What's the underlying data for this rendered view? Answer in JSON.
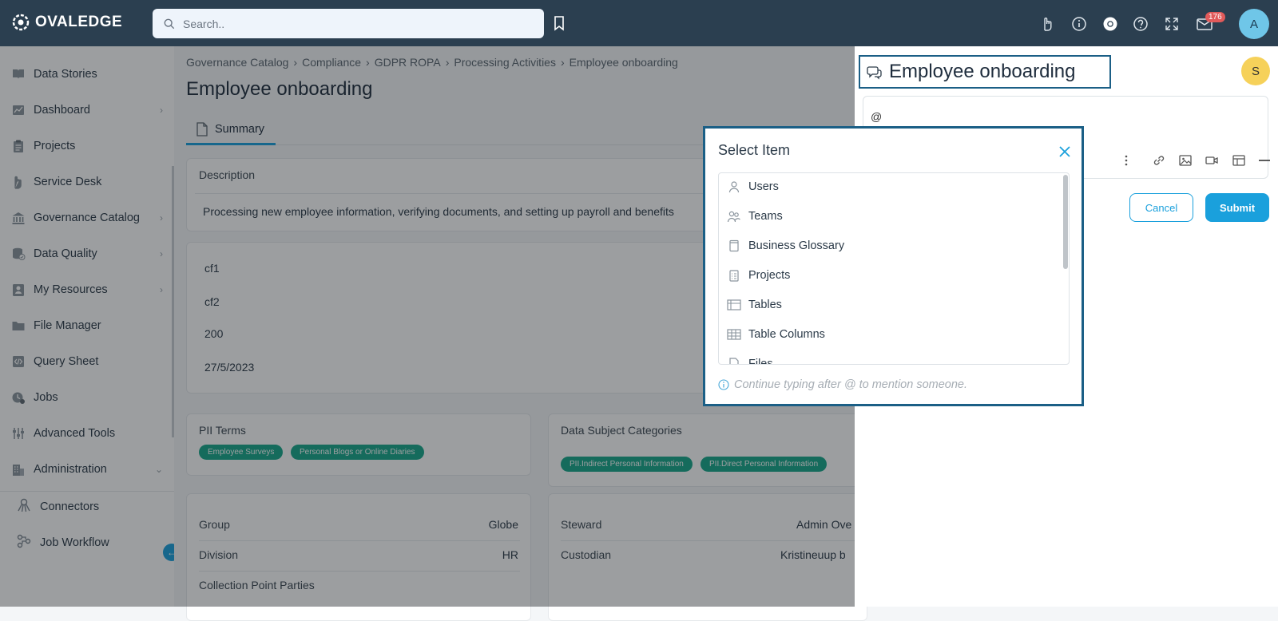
{
  "app": {
    "brand": "OVALEDGE",
    "brand_color": "#2b3f50",
    "accent": "#1aa0dc"
  },
  "topbar": {
    "search_placeholder": "Search..",
    "notification_count": "176",
    "user_initial": "A",
    "icons": [
      "bookmark-icon",
      "hand-icon",
      "info-icon",
      "chrome-icon",
      "help-icon",
      "expand-icon",
      "mail-icon"
    ]
  },
  "sidebar": {
    "items": [
      {
        "label": "Data Stories",
        "icon": "book-icon",
        "expandable": false
      },
      {
        "label": "Dashboard",
        "icon": "chart-icon",
        "expandable": true
      },
      {
        "label": "Projects",
        "icon": "clipboard-icon",
        "expandable": false
      },
      {
        "label": "Service Desk",
        "icon": "hand-icon",
        "expandable": false
      },
      {
        "label": "Governance Catalog",
        "icon": "bank-icon",
        "expandable": true
      },
      {
        "label": "Data Quality",
        "icon": "database-icon",
        "expandable": true
      },
      {
        "label": "My Resources",
        "icon": "person-icon",
        "expandable": true
      },
      {
        "label": "File Manager",
        "icon": "folder-icon",
        "expandable": false
      },
      {
        "label": "Query Sheet",
        "icon": "code-icon",
        "expandable": false
      },
      {
        "label": "Jobs",
        "icon": "jobs-icon",
        "expandable": false
      },
      {
        "label": "Advanced Tools",
        "icon": "tools-icon",
        "expandable": false
      },
      {
        "label": "Administration",
        "icon": "building-icon",
        "expandable": true
      }
    ],
    "subitems": [
      {
        "label": "Connectors",
        "icon": "connectors-icon"
      },
      {
        "label": "Job Workflow",
        "icon": "workflow-icon"
      }
    ]
  },
  "main": {
    "breadcrumb": [
      "Governance Catalog",
      "Compliance",
      "GDPR ROPA",
      "Processing Activities",
      "Employee onboarding"
    ],
    "breadcrumb_sep": "›",
    "title": "Employee onboarding",
    "tab": "Summary",
    "description_label": "Description",
    "description_text": "Processing new employee information, verifying documents, and setting up payroll and benefits",
    "custom_fields": [
      "cf1",
      "cf2",
      "200",
      "27/5/2023"
    ],
    "pii_terms_label": "PII Terms",
    "pii_terms": [
      "Employee Surveys",
      "Personal Blogs or Online Diaries"
    ],
    "data_subject_label": "Data Subject Categories",
    "data_subject_categories": [
      "PII.Indirect Personal Information",
      "PII.Direct Personal Information"
    ],
    "left_details": [
      {
        "label": "Group",
        "value": "Globe"
      },
      {
        "label": "Division",
        "value": "HR"
      },
      {
        "label": "Collection Point Parties",
        "value": ""
      }
    ],
    "right_details": [
      {
        "label": "Steward",
        "value": "Admin Ove"
      },
      {
        "label": "Custodian",
        "value": "Kristineuup b"
      }
    ]
  },
  "right_panel": {
    "title": "Employee onboarding",
    "avatar_initial": "S",
    "editor_text": "@",
    "cancel_label": "Cancel",
    "submit_label": "Submit"
  },
  "modal": {
    "title": "Select Item",
    "items": [
      {
        "label": "Users",
        "icon": "user-icon"
      },
      {
        "label": "Teams",
        "icon": "team-icon"
      },
      {
        "label": "Business Glossary",
        "icon": "glossary-icon"
      },
      {
        "label": "Projects",
        "icon": "project-icon"
      },
      {
        "label": "Tables",
        "icon": "table-icon"
      },
      {
        "label": "Table Columns",
        "icon": "table-columns-icon"
      },
      {
        "label": "Files",
        "icon": "file-icon"
      }
    ],
    "hint": "Continue typing after @ to mention someone."
  }
}
